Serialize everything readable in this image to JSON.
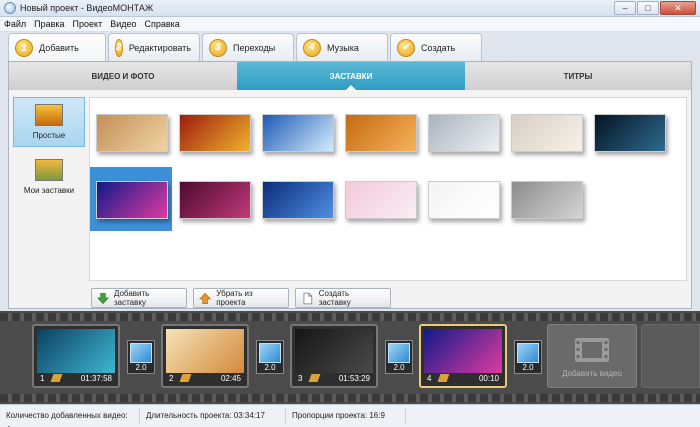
{
  "window": {
    "title": "Новый проект - ВидеоМОНТАЖ",
    "minimize": "–",
    "maximize": "□",
    "close": "✕"
  },
  "menu": [
    "Файл",
    "Правка",
    "Проект",
    "Видео",
    "Справка"
  ],
  "steps": [
    {
      "num": "1",
      "label": "Добавить",
      "active": true
    },
    {
      "num": "2",
      "label": "Редактировать",
      "active": false
    },
    {
      "num": "3",
      "label": "Переходы",
      "active": false
    },
    {
      "num": "4",
      "label": "Музыка",
      "active": false
    },
    {
      "num": "5",
      "label": "Создать",
      "active": false,
      "icon": "checkmark-icon"
    }
  ],
  "subtabs": [
    {
      "label": "ВИДЕО И ФОТО",
      "active": false
    },
    {
      "label": "ЗАСТАВКИ",
      "active": true
    },
    {
      "label": "ТИТРЫ",
      "active": false
    }
  ],
  "sidebar": [
    {
      "label": "Простые",
      "active": true
    },
    {
      "label": "Мои заставки",
      "active": false
    }
  ],
  "backgrounds": [
    {
      "name": "parchment",
      "c1": "#c48f55",
      "c2": "#f0d3a6"
    },
    {
      "name": "golden-sparkle",
      "c1": "#9b1d0e",
      "c2": "#f0b22c"
    },
    {
      "name": "blue-film",
      "c1": "#1d5ab7",
      "c2": "#d4ecfb"
    },
    {
      "name": "orange",
      "c1": "#c46a12",
      "c2": "#f7b25a"
    },
    {
      "name": "silver-gray",
      "c1": "#a9b3be",
      "c2": "#eef1f4"
    },
    {
      "name": "cream-camera",
      "c1": "#d8cfc3",
      "c2": "#f7f1e9"
    },
    {
      "name": "night-city",
      "c1": "#041424",
      "c2": "#2d6a8f"
    },
    {
      "name": "rainbow-waves",
      "c1": "#101a8a",
      "c2": "#e03aa0"
    },
    {
      "name": "purple-floral",
      "c1": "#4c0a2e",
      "c2": "#c03a7a"
    },
    {
      "name": "blue-lines",
      "c1": "#0a2d7a",
      "c2": "#4f8fe0"
    },
    {
      "name": "pink-flower",
      "c1": "#f2c9da",
      "c2": "#fbeef3"
    },
    {
      "name": "white-ink",
      "c1": "#f4f4f4",
      "c2": "#ffffff"
    },
    {
      "name": "gray-gradient",
      "c1": "#8c8c8c",
      "c2": "#d4d4d4"
    }
  ],
  "actions": [
    {
      "label": "Добавить заставку",
      "icon": "add-down-arrow-icon"
    },
    {
      "label": "Убрать из проекта",
      "icon": "remove-up-arrow-icon"
    },
    {
      "label": "Создать заставку",
      "icon": "new-document-icon"
    }
  ],
  "clips": [
    {
      "num": "1",
      "duration": "01:37:58",
      "c1": "#0b3f5f",
      "c2": "#3fb7d3",
      "active": false
    },
    {
      "num": "2",
      "duration": "02:45",
      "c1": "#f5e3b8",
      "c2": "#d4893c",
      "active": false
    },
    {
      "num": "3",
      "duration": "01:53:29",
      "c1": "#151515",
      "c2": "#4a4a4a",
      "active": false
    },
    {
      "num": "4",
      "duration": "00:10",
      "c1": "#101a8a",
      "c2": "#e03aa0",
      "active": true
    }
  ],
  "transitions": [
    "2.0",
    "2.0",
    "2.0",
    "2.0"
  ],
  "add_video_label": "Добавить видео",
  "status": {
    "count": "Количество добавленных видео: 4",
    "duration": "Длительность проекта: 03:34:17",
    "ratio": "Пропорции проекта: 16:9"
  }
}
